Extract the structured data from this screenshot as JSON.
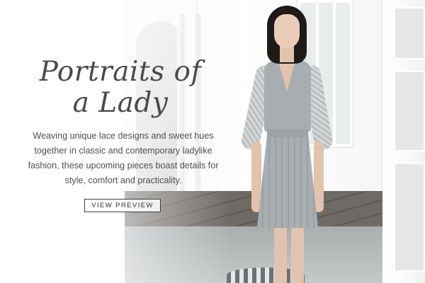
{
  "banner": {
    "title_line1": "Portraits of",
    "title_line2": "a Lady",
    "description": "Weaving unique lace designs and sweet hues together in classic and contemporary ladylike fashion, these upcoming pieces boast details for style, comfort and practicality.",
    "cta_label": "VIEW PREVIEW"
  },
  "colors": {
    "text": "#4a4a4a",
    "panel": "#ffffff",
    "dress": "#a8adb1"
  }
}
